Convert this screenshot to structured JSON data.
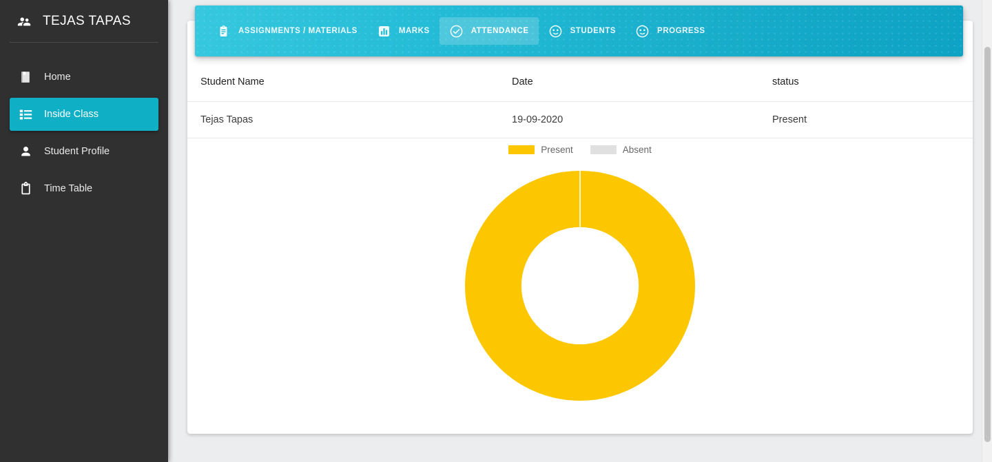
{
  "sidebar": {
    "brand": {
      "title": "TEJAS TAPAS",
      "icon": "group-people-icon"
    },
    "items": [
      {
        "label": "Home",
        "icon": "bookmark-icon",
        "active": false
      },
      {
        "label": "Inside Class",
        "icon": "list-icon",
        "active": true
      },
      {
        "label": "Student Profile",
        "icon": "person-icon",
        "active": false
      },
      {
        "label": "Time Table",
        "icon": "clipboard-icon",
        "active": false
      }
    ]
  },
  "tabs": [
    {
      "label": "ASSIGNMENTS / MATERIALS",
      "icon": "clipboard-list-icon",
      "active": false
    },
    {
      "label": "MARKS",
      "icon": "bar-chart-icon",
      "active": false
    },
    {
      "label": "ATTENDANCE",
      "icon": "check-circle-icon",
      "active": true
    },
    {
      "label": "STUDENTS",
      "icon": "face-icon",
      "active": false
    },
    {
      "label": "PROGRESS",
      "icon": "face-icon",
      "active": false
    }
  ],
  "table": {
    "columns": [
      "Student Name",
      "Date",
      "status"
    ],
    "rows": [
      {
        "student_name": "Tejas Tapas",
        "date": "19-09-2020",
        "status": "Present"
      }
    ]
  },
  "chart_data": {
    "type": "pie",
    "variant": "donut",
    "title": "",
    "labels": [
      "Present",
      "Absent"
    ],
    "values": [
      1,
      0
    ],
    "percentages": [
      100,
      0
    ],
    "colors": [
      "#FDC700",
      "#E0E0E0"
    ],
    "legend": {
      "position": "top",
      "entries": [
        "Present",
        "Absent"
      ]
    },
    "inner_radius_ratio": 0.51,
    "slice_border_color": "#ffffff"
  },
  "colors": {
    "brand_teal": "#0FAFC6",
    "tab_gradient_start": "#36C8DE",
    "tab_gradient_end": "#0EA2C4",
    "sidebar_bg": "#303030",
    "page_bg": "#ECEDEF",
    "chart_present": "#FDC700",
    "chart_absent": "#E0E0E0"
  }
}
